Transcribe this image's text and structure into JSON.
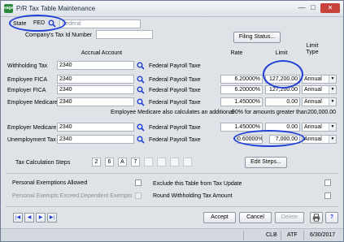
{
  "window": {
    "title": "P/R Tax Table Maintenance",
    "app_icon_label": "sage",
    "minimize": "—",
    "maximize": "□",
    "close": "✕"
  },
  "state": {
    "label": "State",
    "value": "FED",
    "description": "Federal"
  },
  "company_tax_id": {
    "label": "Company's Tax Id Number",
    "value": ""
  },
  "filing_status_button": "Filing Status...",
  "headers": {
    "accrual_account": "Accrual Account",
    "rate": "Rate",
    "limit": "Limit",
    "limit_type": "Limit\nType"
  },
  "rows": [
    {
      "label": "Withholding Tax",
      "account": "2340",
      "account_desc": "Federal Payroll Taxe",
      "rate": "",
      "limit": "",
      "limit_type": ""
    },
    {
      "label": "Employee FICA",
      "account": "2340",
      "account_desc": "Federal Payroll Taxe",
      "rate": "6.20000%",
      "limit": "127,200.00",
      "limit_type": "Annual"
    },
    {
      "label": "Employer FICA",
      "account": "2340",
      "account_desc": "Federal Payroll Taxe",
      "rate": "6.20000%",
      "limit": "127,200.00",
      "limit_type": "Annual"
    },
    {
      "label": "Employee Medicare",
      "account": "2340",
      "account_desc": "Federal Payroll Taxe",
      "rate": "1.45000%",
      "limit": "0.00",
      "limit_type": "Annual"
    },
    {
      "label": "Employer Medicare",
      "account": "2340",
      "account_desc": "Federal Payroll Taxe",
      "rate": "1.45000%",
      "limit": "0.00",
      "limit_type": "Annual"
    },
    {
      "label": "Unemployment Tax",
      "account": "2340",
      "account_desc": "Federal Payroll Taxe",
      "rate": "0.60000%",
      "limit": "7,000.00",
      "limit_type": "Annual"
    }
  ],
  "medicare_note": {
    "prefix": "Employee Medicare also calculates an additional",
    "rate": ".90%",
    "middle": "for amounts greater than",
    "amount": "200,000.00"
  },
  "tax_calc_steps": {
    "label": "Tax Calculation Steps",
    "steps": [
      "2",
      "6",
      "A",
      "7",
      "",
      "",
      "",
      ""
    ]
  },
  "edit_steps_button": "Edit Steps...",
  "options": {
    "personal_exemptions": "Personal Exemptions Allowed",
    "exclude_from_update": "Exclude this Table from Tax Update",
    "personal_exempts_exceed": "Personal Exempts Exceed Dependent Exempts",
    "round_withholding": "Round Withholding Tax Amount"
  },
  "buttons": {
    "accept": "Accept",
    "cancel": "Cancel",
    "delete": "Delete"
  },
  "status_bar": {
    "company": "CLB",
    "module": "ATF",
    "date": "6/30/2017"
  },
  "colors": {
    "annotation_ovals": "#1f3fd6",
    "window_bg": "#dfe3e8"
  }
}
